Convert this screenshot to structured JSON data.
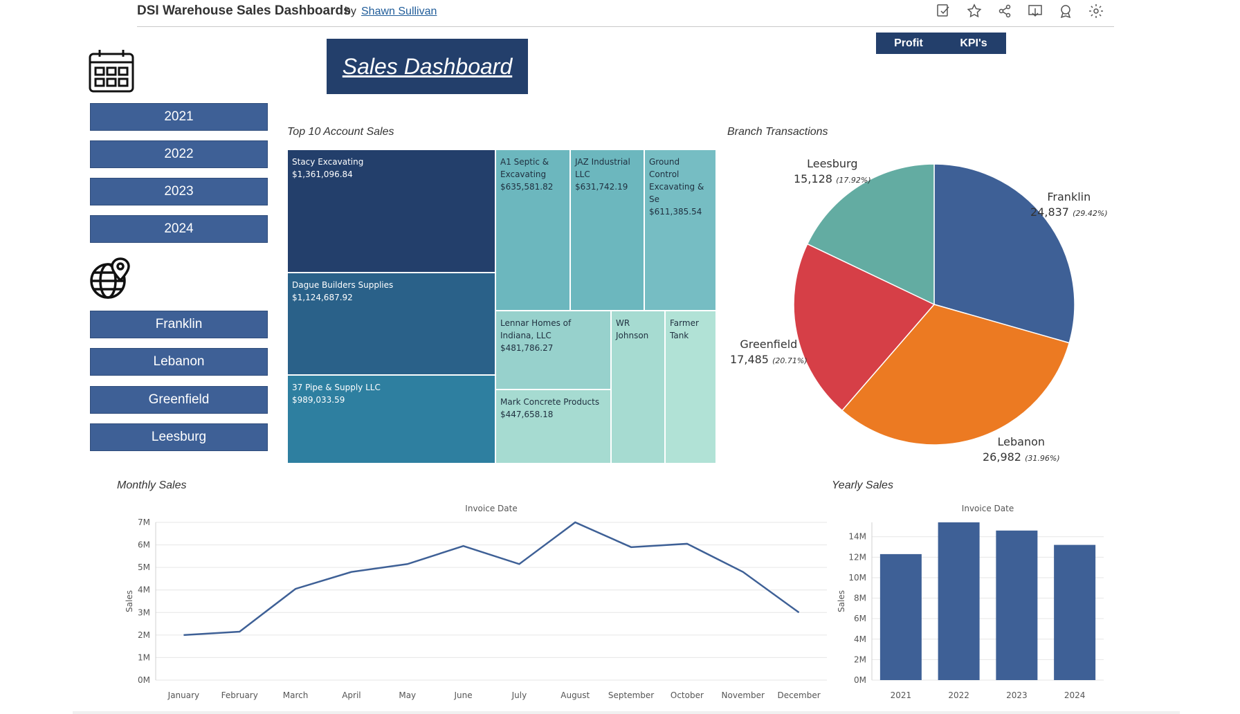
{
  "header": {
    "title": "DSI Warehouse Sales Dashboards",
    "by": "by",
    "author": "Shawn Sullivan",
    "icons": [
      "edit-icon",
      "star-icon",
      "share-icon",
      "download-icon",
      "award-icon",
      "settings-icon"
    ]
  },
  "dashboard_title": "Sales Dashboard",
  "nav": {
    "profit": "Profit",
    "kpis": "KPI's"
  },
  "year_filters": [
    "2021",
    "2022",
    "2023",
    "2024"
  ],
  "branch_filters": [
    "Franklin",
    "Lebanon",
    "Greenfield",
    "Leesburg"
  ],
  "colors": {
    "button": "#3e6096",
    "title_bg": "#233f6b",
    "line": "#3e6096",
    "bar": "#3e6096"
  },
  "treemap": {
    "title": "Top 10 Account Sales",
    "cells": [
      {
        "name": "Stacy Excavating",
        "value": "$1,361,096.84",
        "color": "#233f6b",
        "text": "#ffffff"
      },
      {
        "name": "Dague Builders Supplies",
        "value": "$1,124,687.92",
        "color": "#2a6189",
        "text": "#ffffff"
      },
      {
        "name": "37 Pipe & Supply LLC",
        "value": "$989,033.59",
        "color": "#2e7fa0",
        "text": "#ffffff"
      },
      {
        "name": "A1 Septic & Excavating",
        "value": "$635,581.82",
        "color": "#6cb7be",
        "text": "#1f2f3f"
      },
      {
        "name": "JAZ Industrial LLC",
        "value": "$631,742.19",
        "color": "#6cb7be",
        "text": "#1f2f3f"
      },
      {
        "name": "Ground Control Excavating & Se",
        "value": "$611,385.54",
        "color": "#76bdc3",
        "text": "#1f2f3f"
      },
      {
        "name": "Lennar Homes of Indiana, LLC",
        "value": "$481,786.27",
        "color": "#97d1cc",
        "text": "#1f2f3f"
      },
      {
        "name": "WR Johnson",
        "value": "",
        "color": "#a6dbd1",
        "text": "#1f2f3f"
      },
      {
        "name": "Farmer Tank",
        "value": "",
        "color": "#b1e2d6",
        "text": "#1f2f3f"
      },
      {
        "name": "Mark Concrete Products",
        "value": "$447,658.18",
        "color": "#a6dbd1",
        "text": "#1f2f3f"
      }
    ]
  },
  "pie": {
    "title": "Branch Transactions",
    "slices": [
      {
        "name": "Franklin",
        "value": 24837,
        "value_label": "24,837",
        "pct": "(29.42%)",
        "color": "#3e6096"
      },
      {
        "name": "Lebanon",
        "value": 26982,
        "value_label": "26,982",
        "pct": "(31.96%)",
        "color": "#ec7a22"
      },
      {
        "name": "Greenfield",
        "value": 17485,
        "value_label": "17,485",
        "pct": "(20.71%)",
        "color": "#d63f47"
      },
      {
        "name": "Leesburg",
        "value": 15128,
        "value_label": "15,128",
        "pct": "(17.92%)",
        "color": "#63aca2"
      }
    ]
  },
  "monthly": {
    "title": "Monthly Sales"
  },
  "yearly": {
    "title": "Yearly Sales"
  },
  "chart_data": [
    {
      "type": "line",
      "title": "Monthly Sales",
      "xlabel": "Invoice Date",
      "ylabel": "Sales",
      "categories": [
        "January",
        "February",
        "March",
        "April",
        "May",
        "June",
        "July",
        "August",
        "September",
        "October",
        "November",
        "December"
      ],
      "values": [
        2000000,
        2150000,
        4050000,
        4800000,
        5150000,
        5950000,
        5150000,
        7000000,
        5900000,
        6050000,
        4800000,
        3000000
      ],
      "ylim": [
        0,
        7000000
      ],
      "yticks": [
        "0M",
        "1M",
        "2M",
        "3M",
        "4M",
        "5M",
        "6M",
        "7M"
      ],
      "grid": true
    },
    {
      "type": "bar",
      "title": "Yearly Sales",
      "xlabel": "Invoice Date",
      "ylabel": "Sales",
      "categories": [
        "2021",
        "2022",
        "2023",
        "2024"
      ],
      "values": [
        12300000,
        15400000,
        14600000,
        13200000
      ],
      "ylim": [
        0,
        15400000
      ],
      "yticks": [
        "0M",
        "2M",
        "4M",
        "6M",
        "8M",
        "10M",
        "12M",
        "14M"
      ],
      "grid": true
    }
  ]
}
